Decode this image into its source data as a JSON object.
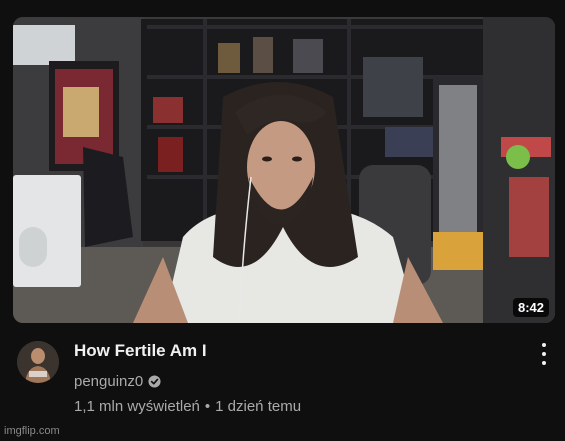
{
  "video": {
    "duration": "8:42",
    "title": "How Fertile Am I",
    "channel": "penguinz0",
    "views": "1,1 mln wyświetleń",
    "separator": "•",
    "age": "1 dzień temu"
  },
  "icons": {
    "verified": "verified-check-icon",
    "menu": "more-vert-icon"
  },
  "watermark": "imgflip.com",
  "colors": {
    "background": "#0f0f0f",
    "title": "#f1f1f1",
    "secondary": "#aaaaaa"
  }
}
